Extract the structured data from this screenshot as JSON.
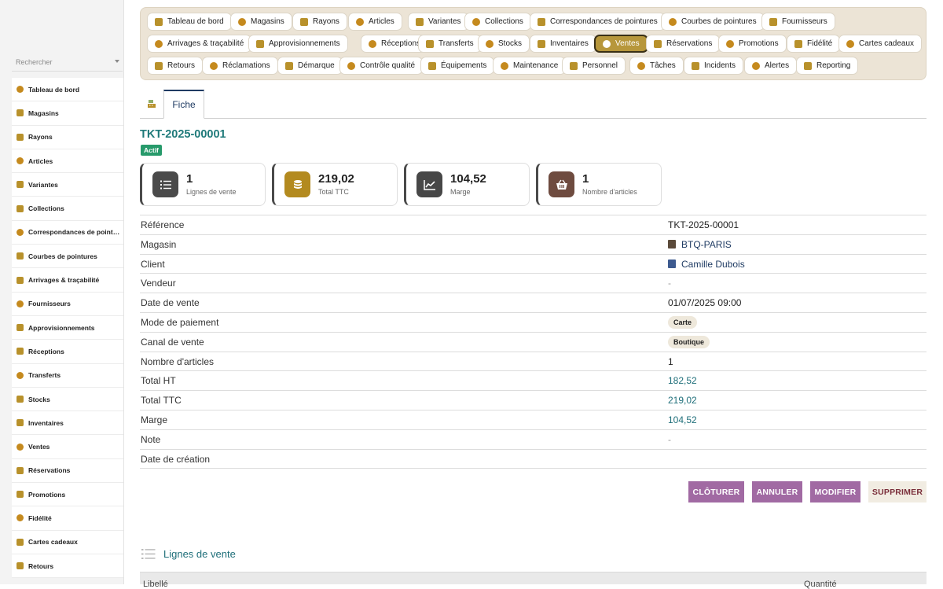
{
  "sidebar": {
    "search_placeholder": "Rechercher",
    "items": [
      {
        "label": "Tableau de bord",
        "icon": "dashboard-icon"
      },
      {
        "label": "Magasins",
        "icon": "store-icon"
      },
      {
        "label": "Rayons",
        "icon": "grid-icon"
      },
      {
        "label": "Articles",
        "icon": "tags-icon"
      },
      {
        "label": "Variantes",
        "icon": "palette-icon"
      },
      {
        "label": "Collections",
        "icon": "layers-icon"
      },
      {
        "label": "Correspondances de pointures",
        "icon": "ruler-icon"
      },
      {
        "label": "Courbes de pointures",
        "icon": "chart-icon"
      },
      {
        "label": "Arrivages & traçabilité",
        "icon": "barcode-icon"
      },
      {
        "label": "Fournisseurs",
        "icon": "factory-icon"
      },
      {
        "label": "Approvisionnements",
        "icon": "cart-flatbed-icon"
      },
      {
        "label": "Réceptions",
        "icon": "truck-loading-icon"
      },
      {
        "label": "Transferts",
        "icon": "arrows-exchange-icon"
      },
      {
        "label": "Stocks",
        "icon": "warehouse-icon"
      },
      {
        "label": "Inventaires",
        "icon": "clipboard-check-icon"
      },
      {
        "label": "Ventes",
        "icon": "cash-register-icon"
      },
      {
        "label": "Réservations",
        "icon": "calendar-check-icon"
      },
      {
        "label": "Promotions",
        "icon": "percent-tag-icon"
      },
      {
        "label": "Fidélité",
        "icon": "medal-icon"
      },
      {
        "label": "Cartes cadeaux",
        "icon": "gift-icon"
      },
      {
        "label": "Retours",
        "icon": "undo-icon"
      }
    ]
  },
  "topnav": {
    "rows": [
      [
        {
          "label": "Tableau de bord",
          "icon": "dashboard-icon"
        },
        {
          "label": "Magasins",
          "icon": "store-icon"
        },
        {
          "label": "Rayons",
          "icon": "grid-icon"
        },
        {
          "label": "Articles",
          "icon": "tags-icon"
        },
        {
          "label": "Variantes",
          "icon": "palette-icon"
        },
        {
          "label": "Collections",
          "icon": "layers-icon"
        },
        {
          "label": "Correspondances de pointures",
          "icon": "ruler-icon"
        },
        {
          "label": "Courbes de pointures",
          "icon": "chart-icon"
        },
        {
          "label": "Fournisseurs",
          "icon": "factory-icon"
        }
      ],
      [
        {
          "label": "Arrivages & traçabilité",
          "icon": "barcode-icon"
        },
        {
          "label": "Approvisionnements",
          "icon": "cart-flatbed-icon"
        },
        {
          "label": "Réceptions",
          "icon": "truck-loading-icon"
        },
        {
          "label": "Transferts",
          "icon": "arrows-exchange-icon"
        },
        {
          "label": "Stocks",
          "icon": "warehouse-icon"
        },
        {
          "label": "Inventaires",
          "icon": "clipboard-check-icon"
        },
        {
          "label": "Ventes",
          "icon": "cash-register-icon",
          "active": true
        },
        {
          "label": "Réservations",
          "icon": "calendar-check-icon"
        },
        {
          "label": "Promotions",
          "icon": "percent-tag-icon"
        },
        {
          "label": "Fidélité",
          "icon": "medal-icon"
        },
        {
          "label": "Cartes cadeaux",
          "icon": "gift-icon"
        }
      ],
      [
        {
          "label": "Retours",
          "icon": "undo-icon"
        },
        {
          "label": "Réclamations",
          "icon": "comment-icon"
        },
        {
          "label": "Démarque",
          "icon": "clipboard-icon"
        },
        {
          "label": "Contrôle qualité",
          "icon": "clipboard-list-icon"
        },
        {
          "label": "Équipements",
          "icon": "desktop-icon"
        },
        {
          "label": "Maintenance",
          "icon": "tools-icon"
        },
        {
          "label": "Personnel",
          "icon": "users-icon"
        },
        {
          "label": "Tâches",
          "icon": "list-icon"
        },
        {
          "label": "Incidents",
          "icon": "warning-icon"
        },
        {
          "label": "Alertes",
          "icon": "bell-icon"
        },
        {
          "label": "Reporting",
          "icon": "pie-chart-icon"
        }
      ]
    ]
  },
  "tabs": {
    "fiche_label": "Fiche"
  },
  "record": {
    "title": "TKT-2025-00001",
    "status": "Actif"
  },
  "stats": [
    {
      "value": "1",
      "label": "Lignes de vente",
      "icon": "list-icon",
      "color": "#4a4a4a"
    },
    {
      "value": "219,02",
      "label": "Total TTC",
      "icon": "coins-icon",
      "color": "#b38a1f"
    },
    {
      "value": "104,52",
      "label": "Marge",
      "icon": "trend-up-icon",
      "color": "#474747"
    },
    {
      "value": "1",
      "label": "Nombre d'articles",
      "icon": "basket-icon",
      "color": "#6e4b3f"
    }
  ],
  "details": [
    {
      "label": "Référence",
      "value": "TKT-2025-00001",
      "kind": "text"
    },
    {
      "label": "Magasin",
      "value": "BTQ-PARIS",
      "kind": "link",
      "icon": "store-icon"
    },
    {
      "label": "Client",
      "value": "Camille Dubois",
      "kind": "link",
      "icon": "building-icon"
    },
    {
      "label": "Vendeur",
      "value": "-",
      "kind": "dash"
    },
    {
      "label": "Date de vente",
      "value": "01/07/2025 09:00",
      "kind": "text"
    },
    {
      "label": "Mode de paiement",
      "value": "Carte",
      "kind": "chip"
    },
    {
      "label": "Canal de vente",
      "value": "Boutique",
      "kind": "chip"
    },
    {
      "label": "Nombre d'articles",
      "value": "1",
      "kind": "text"
    },
    {
      "label": "Total HT",
      "value": "182,52",
      "kind": "num"
    },
    {
      "label": "Total TTC",
      "value": "219,02",
      "kind": "num"
    },
    {
      "label": "Marge",
      "value": "104,52",
      "kind": "num"
    },
    {
      "label": "Note",
      "value": "-",
      "kind": "dash"
    },
    {
      "label": "Date de création",
      "value": "",
      "kind": "text"
    }
  ],
  "actions": {
    "cloturer": "CLÔTURER",
    "annuler": "ANNULER",
    "modifier": "MODIFIER",
    "supprimer": "SUPPRIMER"
  },
  "lines": {
    "title": "Lignes de vente",
    "columns": [
      "Libellé",
      "Quantité"
    ]
  },
  "colors": {
    "accent": "#b7973c",
    "title_teal": "#1f7a7a",
    "link_navy": "#1f3b63",
    "status_green": "#279a6b",
    "button_purple": "#a16aa3"
  }
}
